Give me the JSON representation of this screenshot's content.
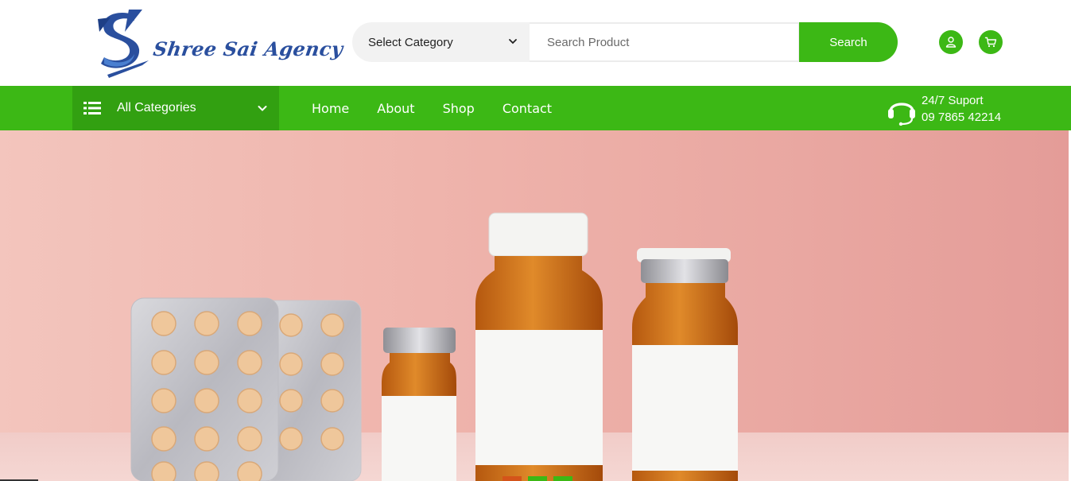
{
  "brand": {
    "name": "Shree Sai Agency"
  },
  "search": {
    "category_label": "Select Category",
    "placeholder": "Search Product",
    "button_label": "Search"
  },
  "nav": {
    "all_categories_label": "All Categories",
    "links": [
      "Home",
      "About",
      "Shop",
      "Contact"
    ]
  },
  "support": {
    "title": "24/7 Suport",
    "phone": "09 7865 42214"
  },
  "colors": {
    "accent_green": "#3cb815",
    "dark_green": "#32a011",
    "brand_blue": "#2a4f9e"
  },
  "icons": [
    "user-icon",
    "cart-icon",
    "list-icon",
    "chevron-down-icon",
    "headset-icon"
  ]
}
